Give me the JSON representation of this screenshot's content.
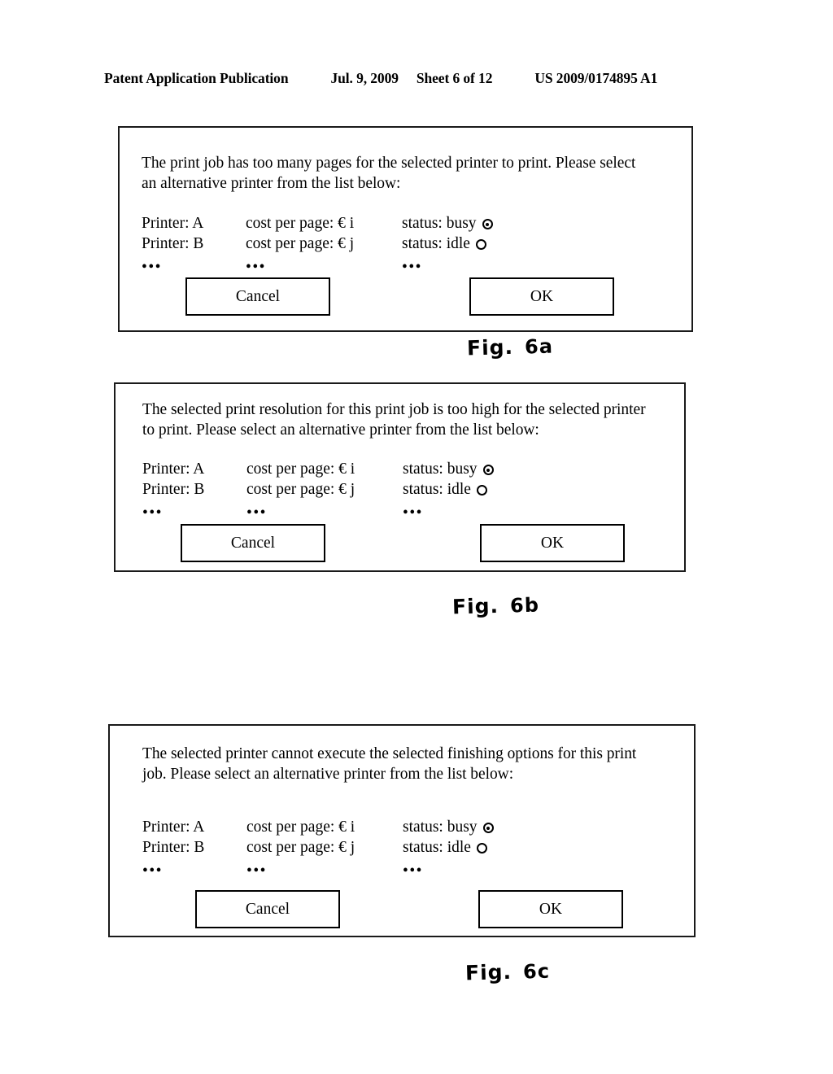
{
  "header": {
    "publication": "Patent Application Publication",
    "date": "Jul. 9, 2009",
    "sheet": "Sheet 6 of 12",
    "patent_number": "US 2009/0174895 A1"
  },
  "dialogs": [
    {
      "id": "dialog-too-many-pages",
      "message": "The print job has too many pages for the selected printer to print. Please select an alternative printer from the list below:",
      "printers": [
        {
          "name": "Printer: A",
          "cost": "cost per page: € i",
          "status": "status: busy",
          "indicator": "busy-icon"
        },
        {
          "name": "Printer: B",
          "cost": "cost per page: € j",
          "status": "status: idle",
          "indicator": "idle-icon"
        }
      ],
      "ellipsis": "•••",
      "cancel_label": "Cancel",
      "ok_label": "OK",
      "figure_label": "Fig.",
      "figure_number": "6a"
    },
    {
      "id": "dialog-resolution-too-high",
      "message": "The selected print resolution for this print job is too high for the selected printer to print. Please select an alternative printer from the list below:",
      "printers": [
        {
          "name": "Printer: A",
          "cost": "cost per page: € i",
          "status": "status: busy",
          "indicator": "busy-icon"
        },
        {
          "name": "Printer: B",
          "cost": "cost per page: € j",
          "status": "status: idle",
          "indicator": "idle-icon"
        }
      ],
      "ellipsis": "•••",
      "cancel_label": "Cancel",
      "ok_label": "OK",
      "figure_label": "Fig.",
      "figure_number": "6b"
    },
    {
      "id": "dialog-finishing-options",
      "message": "The selected printer cannot execute the selected finishing options for this print job. Please select an alternative printer from the list below:",
      "printers": [
        {
          "name": "Printer: A",
          "cost": "cost per page: € i",
          "status": "status: busy",
          "indicator": "busy-icon"
        },
        {
          "name": "Printer: B",
          "cost": "cost per page: € j",
          "status": "status: idle",
          "indicator": "idle-icon"
        }
      ],
      "ellipsis": "•••",
      "cancel_label": "Cancel",
      "ok_label": "OK",
      "figure_label": "Fig.",
      "figure_number": "6c"
    }
  ]
}
